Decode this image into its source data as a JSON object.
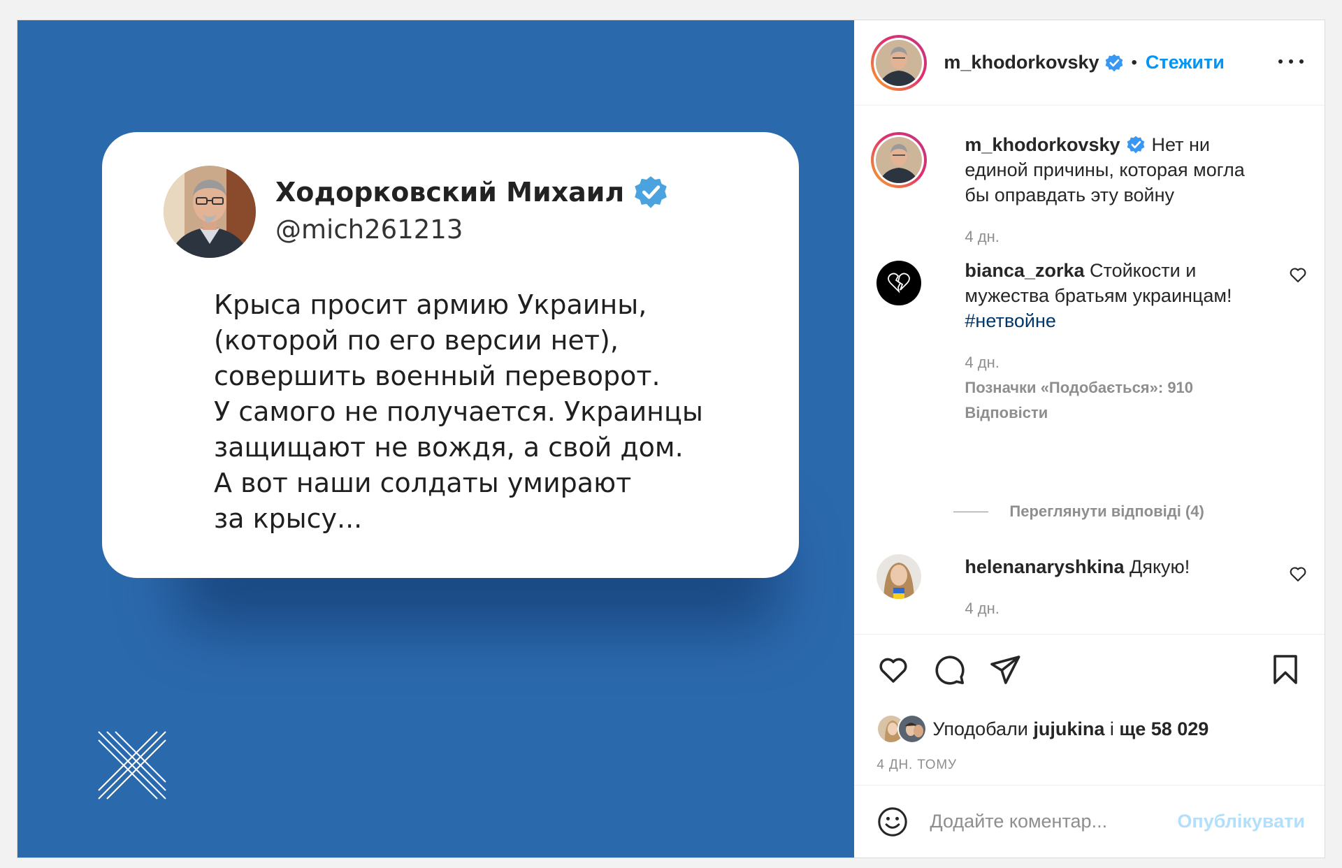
{
  "post": {
    "tweet": {
      "name": "Ходорковский Михаил",
      "handle": "@mich261213",
      "text_lines": [
        "Крыса просит армию Украины,",
        "(которой по его версии нет),",
        "совершить военный переворот.",
        "У самого не получается. Украинцы",
        "защищают не вождя, а свой дом.",
        "А вот наши солдаты умирают",
        "за крысу..."
      ]
    },
    "background_color": "#2b69ad",
    "logo_icon": "crossed-lines-logo"
  },
  "header": {
    "username": "m_khodorkovsky",
    "separator": "•",
    "follow_label": "Стежити",
    "more_icon": "more-horizontal-icon"
  },
  "caption": {
    "username": "m_khodorkovsky",
    "text": "Нет ни единой причины, которая могла бы оправдать эту войну",
    "time": "4 дн."
  },
  "comments": [
    {
      "username": "bianca_zorka",
      "text": "Стойкости и мужества братьям украинцам!",
      "hashtag": "#нетвойне",
      "time": "4 дн.",
      "likes": "Позначки «Подобається»: 910",
      "reply_label": "Відповісти",
      "view_replies": "Переглянути відповіді (4)"
    },
    {
      "username": "helenanaryshkina",
      "text": "Дякую!",
      "time": "4 дн."
    }
  ],
  "likes": {
    "prefix": "Уподобали",
    "user": "jujukina",
    "connector": "і",
    "rest": "ще 58 029"
  },
  "time_ago": "4 ДН. ТОМУ",
  "comment_box": {
    "placeholder": "Додайте коментар...",
    "publish_label": "Опублікувати"
  },
  "colors": {
    "accent": "#0095f6",
    "accent_disabled": "#b2dffc",
    "verified": "#3897f0",
    "hashtag": "#00376b",
    "muted": "#8e8e8e"
  }
}
